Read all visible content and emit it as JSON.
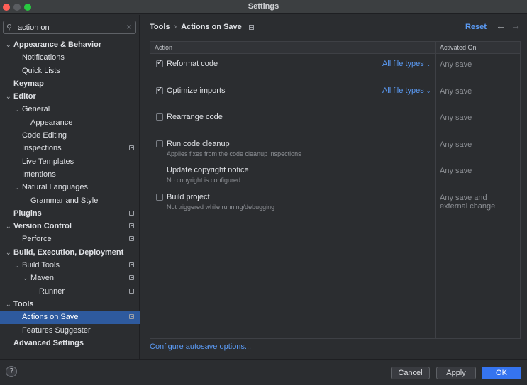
{
  "window": {
    "title": "Settings"
  },
  "search": {
    "value": "action on"
  },
  "tree": [
    {
      "label": "Appearance & Behavior",
      "bold": true,
      "chevron": "⌄"
    },
    {
      "label": "Notifications"
    },
    {
      "label": "Quick Lists"
    },
    {
      "label": "Keymap",
      "bold": true
    },
    {
      "label": "Editor",
      "bold": true,
      "chevron": "⌄"
    },
    {
      "label": "General",
      "chevron": "⌄"
    },
    {
      "label": "Appearance"
    },
    {
      "label": "Code Editing"
    },
    {
      "label": "Inspections",
      "mark": true
    },
    {
      "label": "Live Templates"
    },
    {
      "label": "Intentions"
    },
    {
      "label": "Natural Languages",
      "chevron": "⌄"
    },
    {
      "label": "Grammar and Style"
    },
    {
      "label": "Plugins",
      "bold": true,
      "mark": true
    },
    {
      "label": "Version Control",
      "bold": true,
      "chevron": "⌄",
      "mark": true
    },
    {
      "label": "Perforce",
      "mark": true
    },
    {
      "label": "Build, Execution, Deployment",
      "bold": true,
      "chevron": "⌄"
    },
    {
      "label": "Build Tools",
      "chevron": "⌄",
      "mark": true
    },
    {
      "label": "Maven",
      "chevron": "⌄",
      "mark": true
    },
    {
      "label": "Runner",
      "mark": true
    },
    {
      "label": "Tools",
      "bold": true,
      "chevron": "⌄"
    },
    {
      "label": "Actions on Save",
      "selected": true,
      "mark": true
    },
    {
      "label": "Features Suggester"
    },
    {
      "label": "Advanced Settings",
      "bold": true
    }
  ],
  "breadcrumb": {
    "parent": "Tools",
    "current": "Actions on Save"
  },
  "toolbar": {
    "reset_label": "Reset"
  },
  "table": {
    "headers": {
      "action": "Action",
      "activated": "Activated On"
    },
    "rows": [
      {
        "checked": true,
        "title": "Reformat code",
        "subtitle": "",
        "file_types": "All file types",
        "activated": "Any save"
      },
      {
        "checked": true,
        "title": "Optimize imports",
        "subtitle": "",
        "file_types": "All file types",
        "activated": "Any save"
      },
      {
        "checked": false,
        "title": "Rearrange code",
        "subtitle": "",
        "file_types": "",
        "activated": "Any save"
      },
      {
        "checked": false,
        "title": "Run code cleanup",
        "subtitle": "Applies fixes from the code cleanup inspections",
        "file_types": "",
        "activated": "Any save"
      },
      {
        "checkbox": false,
        "title": "Update copyright notice",
        "subtitle": "No copyright is configured",
        "file_types": "",
        "activated": "Any save"
      },
      {
        "checked": false,
        "title": "Build project",
        "subtitle": "Not triggered while running/debugging",
        "file_types": "",
        "activated": "Any save and external change"
      }
    ]
  },
  "links": {
    "configure": "Configure autosave options..."
  },
  "footer": {
    "cancel": "Cancel",
    "apply": "Apply",
    "ok": "OK",
    "help": "?"
  }
}
